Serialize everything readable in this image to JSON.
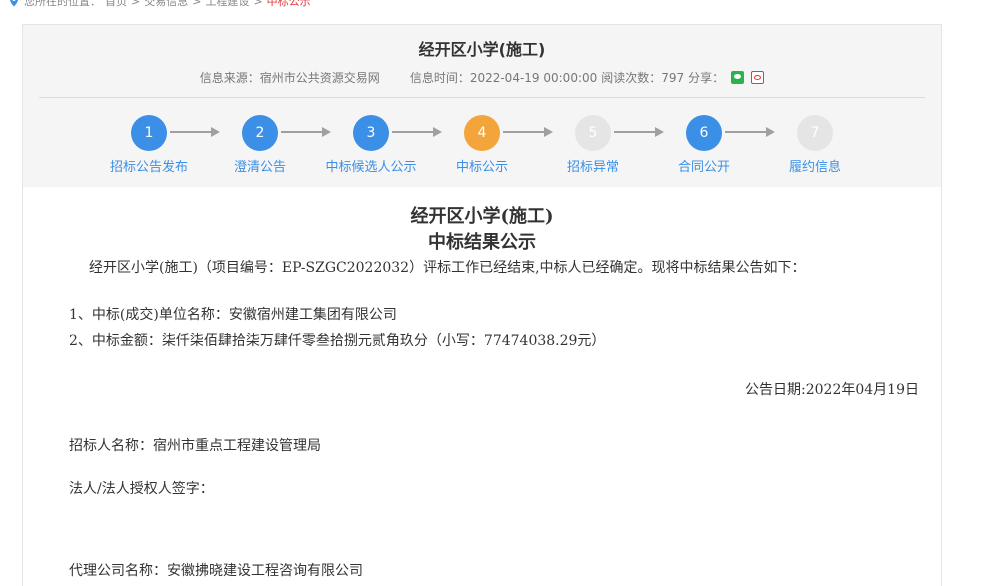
{
  "breadcrumb": {
    "prefix": "您所在的位置：",
    "items": [
      "首页",
      "交易信息",
      "工程建设"
    ],
    "current": "中标公示"
  },
  "header": {
    "title": "经开区小学(施工)",
    "meta": {
      "source_label": "信息来源：宿州市公共资源交易网",
      "time_label": "信息时间：2022-04-19 00:00:00",
      "views_label": "阅读次数：797",
      "share_label": "分享："
    }
  },
  "steps": [
    {
      "number": "1",
      "label": "招标公告发布",
      "state": "done"
    },
    {
      "number": "2",
      "label": "澄清公告",
      "state": "done"
    },
    {
      "number": "3",
      "label": "中标候选人公示",
      "state": "done"
    },
    {
      "number": "4",
      "label": "中标公示",
      "state": "active"
    },
    {
      "number": "5",
      "label": "招标异常",
      "state": "disabled"
    },
    {
      "number": "6",
      "label": "合同公开",
      "state": "done"
    },
    {
      "number": "7",
      "label": "履约信息",
      "state": "disabled"
    }
  ],
  "document": {
    "title_line1": "经开区小学(施工)",
    "title_line2": "中标结果公示",
    "intro": "经开区小学(施工)（项目编号：EP-SZGC2022032）评标工作已经结束,中标人已经确定。现将中标结果公告如下：",
    "item1": "1、中标(成交)单位名称：安徽宿州建工集团有限公司",
    "item2": "2、中标金额：柒仟柒佰肆拾柒万肆仟零叁拾捌元贰角玖分（小写：77474038.29元）",
    "date": "公告日期:2022年04月19日",
    "tenderer": "招标人名称：宿州市重点工程建设管理局",
    "signature": "法人/法人授权人签字：",
    "agency": "代理公司名称：安徽拂晓建设工程咨询有限公司"
  },
  "colors": {
    "accent_blue": "#3b8fe6",
    "active_orange": "#f3a53b",
    "disabled_gray": "#e5e5e5",
    "current_red": "#e03c3c"
  }
}
